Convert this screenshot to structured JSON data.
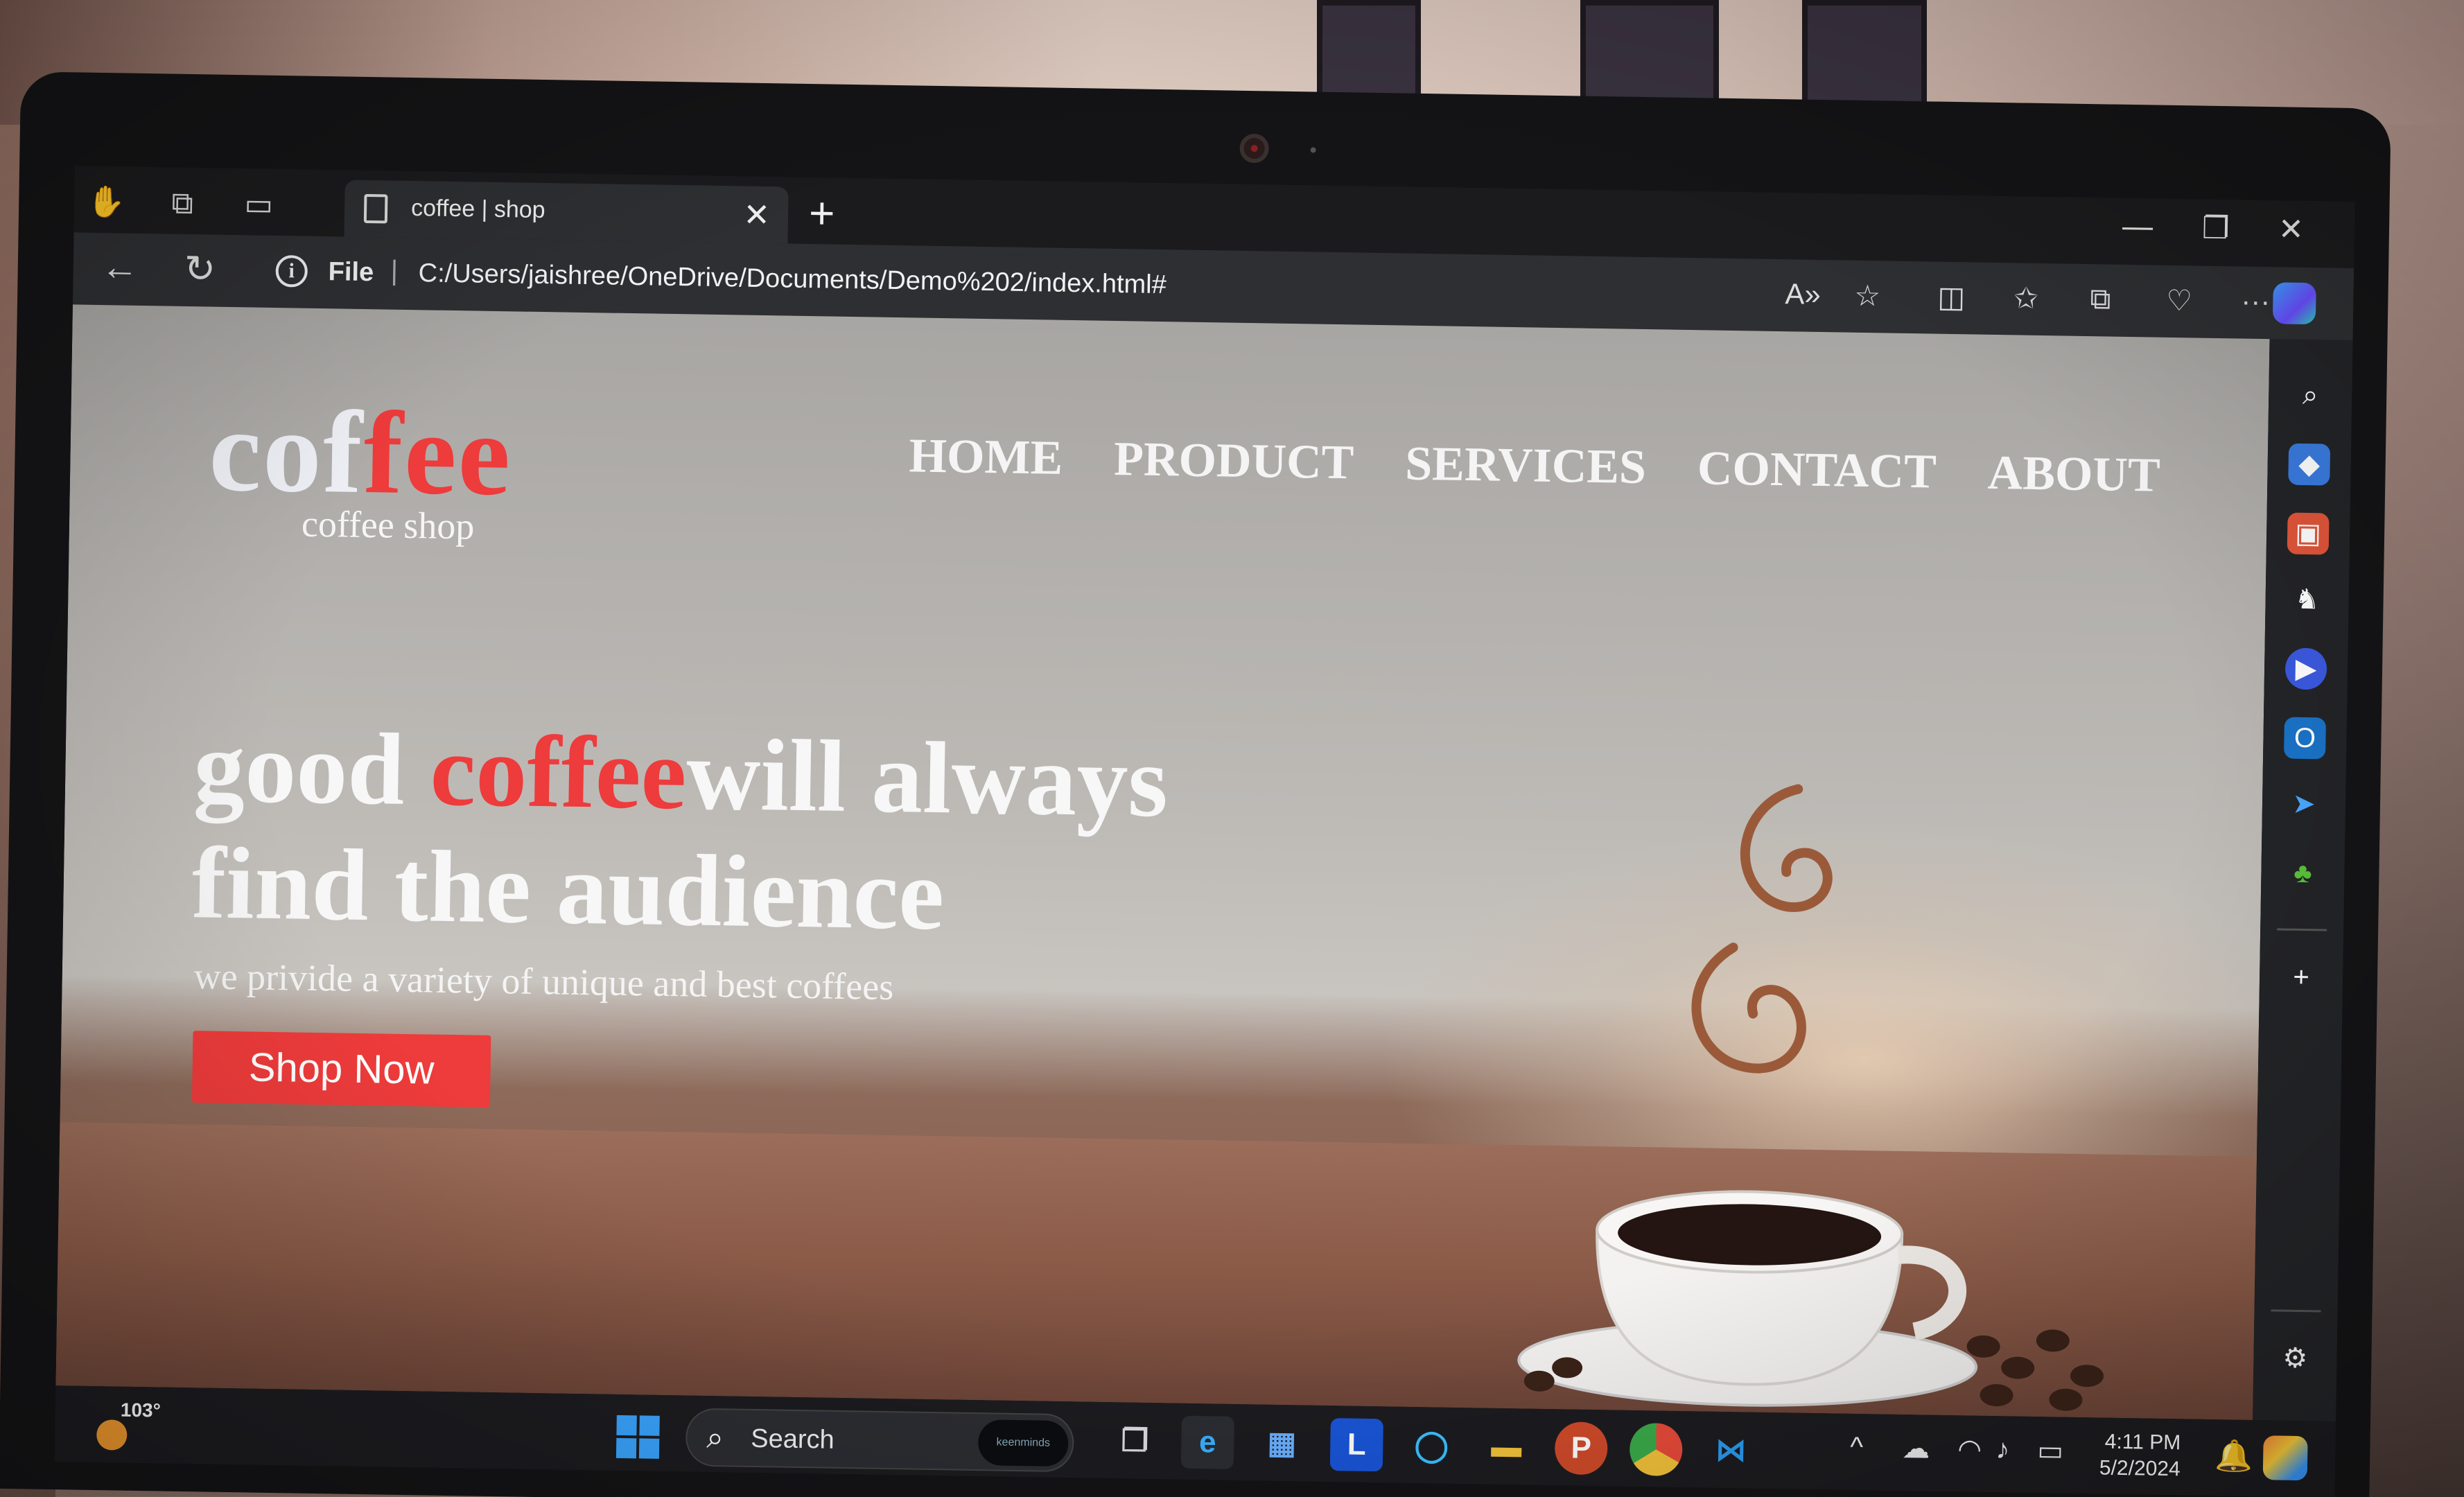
{
  "browser": {
    "tab_title": "coffee | shop",
    "url_scheme_label": "File",
    "url": "C:/Users/jaishree/OneDrive/Documents/Demo%202/index.html#",
    "new_tab": "+",
    "close_tab": "✕"
  },
  "site": {
    "logo_part1": "cof",
    "logo_part2": "fee",
    "logo_subtitle": "coffee shop",
    "nav": [
      "HOME",
      "PRODUCT",
      "SERVICES",
      "CONTACT",
      "ABOUT"
    ],
    "headline_part1": "good ",
    "headline_red": "coffee",
    "headline_part2": "will always",
    "headline_line2": "find the audience",
    "subtext": "we privide a variety of unique and best coffees",
    "cta_label": "Shop Now",
    "colors": {
      "accent": "#ee3b3b",
      "text": "#f4f4f4"
    }
  },
  "taskbar": {
    "weather_temp": "103°",
    "search_label": "Search",
    "search_badge": "keenminds",
    "time": "4:11 PM",
    "date": "5/2/2024"
  },
  "icons": {
    "sidebar": [
      "search-icon",
      "tag-icon",
      "briefcase-icon",
      "games-icon",
      "copilot-icon",
      "outlook-icon",
      "send-icon",
      "tree-icon",
      "add-icon",
      "settings-icon"
    ],
    "taskbar": [
      "windows-start-icon",
      "task-view-icon",
      "edge-icon",
      "store-icon",
      "l-app-icon",
      "cortana-icon",
      "file-explorer-icon",
      "powerpoint-icon",
      "chrome-icon",
      "vscode-icon"
    ]
  }
}
